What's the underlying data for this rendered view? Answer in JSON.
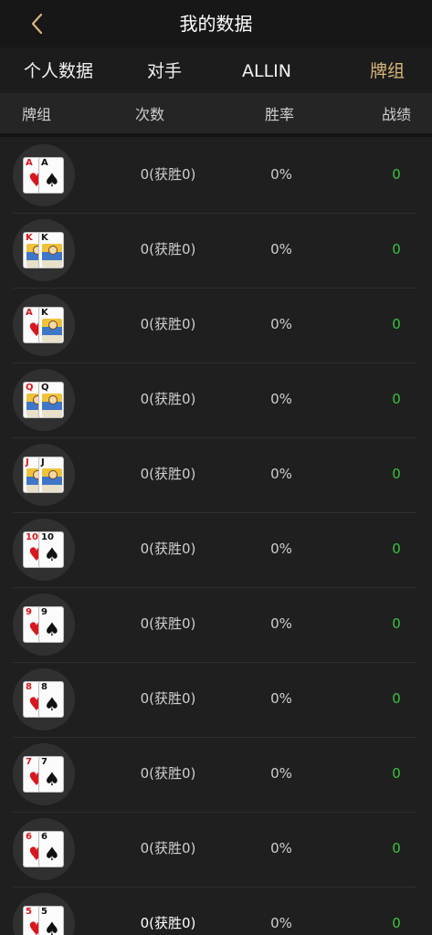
{
  "header": {
    "title": "我的数据",
    "back_icon": "chevron-left-icon"
  },
  "tabs": [
    {
      "label": "个人数据",
      "active": false
    },
    {
      "label": "对手",
      "active": false
    },
    {
      "label": "ALLIN",
      "active": false
    },
    {
      "label": "牌组",
      "active": true
    }
  ],
  "columns": {
    "hand": "牌组",
    "count": "次数",
    "winrate": "胜率",
    "result": "战绩"
  },
  "colors": {
    "accent": "#d7b679",
    "positive": "#37c43a",
    "background": "#1f1f1f"
  },
  "rows": [
    {
      "hand": "AA",
      "cards": [
        {
          "rank": "A",
          "suit": "hearts"
        },
        {
          "rank": "A",
          "suit": "spades"
        }
      ],
      "count": "0(获胜0)",
      "winrate": "0%",
      "result": "0"
    },
    {
      "hand": "KK",
      "cards": [
        {
          "rank": "K",
          "suit": "hearts"
        },
        {
          "rank": "K",
          "suit": "spades"
        }
      ],
      "count": "0(获胜0)",
      "winrate": "0%",
      "result": "0"
    },
    {
      "hand": "AK",
      "cards": [
        {
          "rank": "A",
          "suit": "hearts"
        },
        {
          "rank": "K",
          "suit": "spades"
        }
      ],
      "count": "0(获胜0)",
      "winrate": "0%",
      "result": "0"
    },
    {
      "hand": "QQ",
      "cards": [
        {
          "rank": "Q",
          "suit": "hearts"
        },
        {
          "rank": "Q",
          "suit": "spades"
        }
      ],
      "count": "0(获胜0)",
      "winrate": "0%",
      "result": "0"
    },
    {
      "hand": "JJ",
      "cards": [
        {
          "rank": "J",
          "suit": "hearts"
        },
        {
          "rank": "J",
          "suit": "spades"
        }
      ],
      "count": "0(获胜0)",
      "winrate": "0%",
      "result": "0"
    },
    {
      "hand": "1010",
      "cards": [
        {
          "rank": "10",
          "suit": "hearts"
        },
        {
          "rank": "10",
          "suit": "spades"
        }
      ],
      "count": "0(获胜0)",
      "winrate": "0%",
      "result": "0"
    },
    {
      "hand": "99",
      "cards": [
        {
          "rank": "9",
          "suit": "hearts"
        },
        {
          "rank": "9",
          "suit": "spades"
        }
      ],
      "count": "0(获胜0)",
      "winrate": "0%",
      "result": "0"
    },
    {
      "hand": "88",
      "cards": [
        {
          "rank": "8",
          "suit": "hearts"
        },
        {
          "rank": "8",
          "suit": "spades"
        }
      ],
      "count": "0(获胜0)",
      "winrate": "0%",
      "result": "0"
    },
    {
      "hand": "77",
      "cards": [
        {
          "rank": "7",
          "suit": "hearts"
        },
        {
          "rank": "7",
          "suit": "spades"
        }
      ],
      "count": "0(获胜0)",
      "winrate": "0%",
      "result": "0"
    },
    {
      "hand": "66",
      "cards": [
        {
          "rank": "6",
          "suit": "hearts"
        },
        {
          "rank": "6",
          "suit": "spades"
        }
      ],
      "count": "0(获胜0)",
      "winrate": "0%",
      "result": "0"
    },
    {
      "hand": "55",
      "cards": [
        {
          "rank": "5",
          "suit": "hearts"
        },
        {
          "rank": "5",
          "suit": "spades"
        }
      ],
      "count": "0(获胜0)",
      "winrate": "0%",
      "result": "0"
    }
  ]
}
